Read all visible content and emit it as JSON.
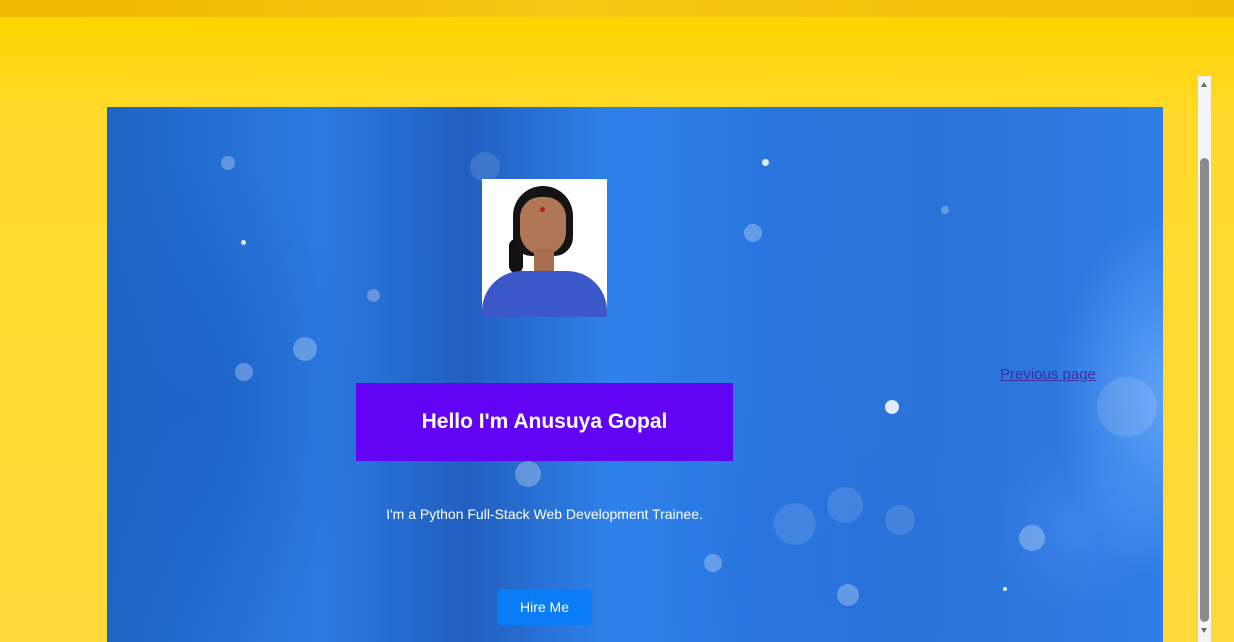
{
  "profile": {
    "photo_alt": "Profile photo"
  },
  "hero": {
    "greeting": "Hello I'm Anusuya Gopal",
    "tagline": "I'm a Python Full-Stack Web Development Trainee.",
    "hire_button_label": "Hire Me"
  },
  "nav": {
    "previous_page_label": "Previous page"
  },
  "colors": {
    "page_background": "#ffd400",
    "hero_background": "#2b7ae2",
    "greeting_box": "#6204f3",
    "hire_button": "#0a7cf7",
    "link": "#3b2f9e"
  },
  "icons": {
    "scroll_up": "chevron-up-icon",
    "scroll_down": "chevron-down-icon"
  }
}
